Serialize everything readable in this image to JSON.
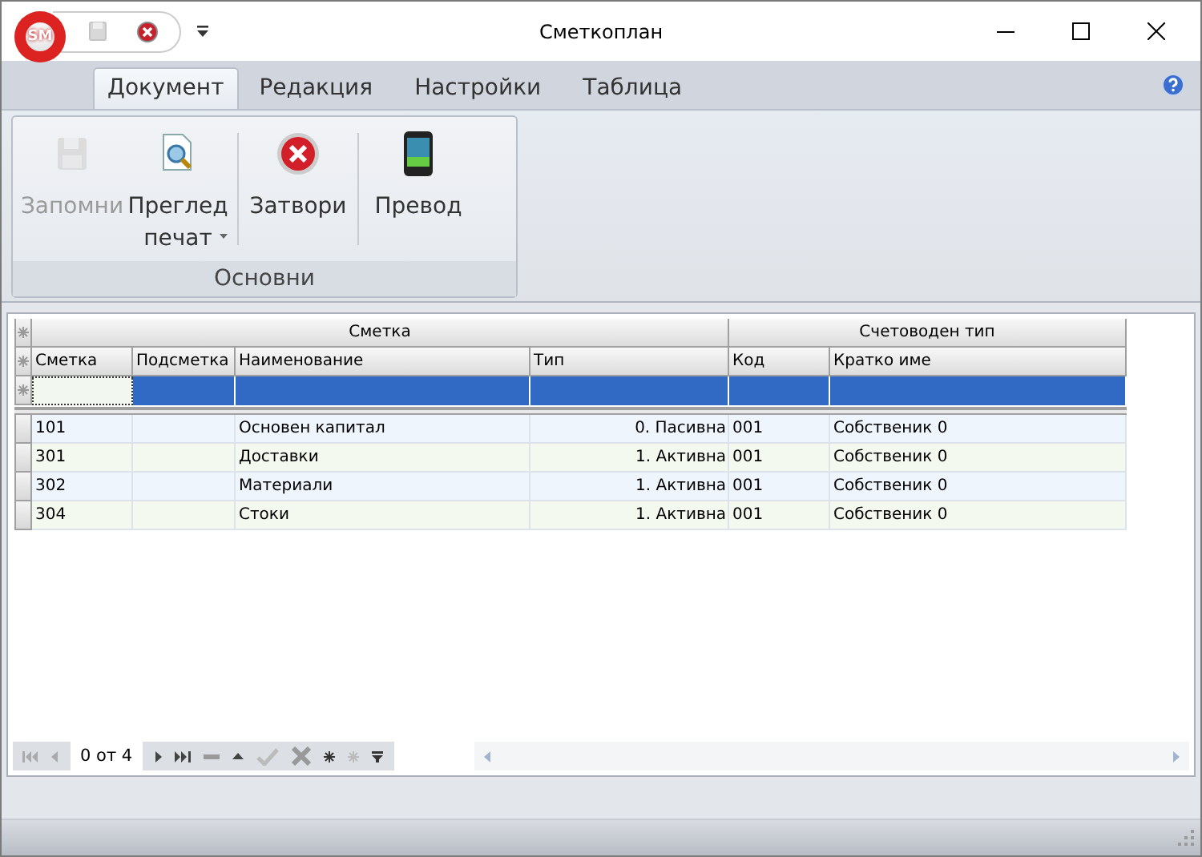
{
  "window": {
    "title": "Сметкоплан",
    "app_badge": "SM"
  },
  "tabs": [
    {
      "label": "Документ",
      "selected": true
    },
    {
      "label": "Редакция",
      "selected": false
    },
    {
      "label": "Настройки",
      "selected": false
    },
    {
      "label": "Таблица",
      "selected": false
    }
  ],
  "ribbon": {
    "group_label": "Основни",
    "buttons": [
      {
        "kind": "save",
        "label": "Запомни",
        "disabled": true,
        "dropdown": false
      },
      {
        "kind": "preview",
        "label": "Преглед печат",
        "disabled": false,
        "dropdown": true
      },
      {
        "kind": "close",
        "label": "Затвори",
        "disabled": false,
        "dropdown": false
      },
      {
        "kind": "translate",
        "label": "Превод",
        "disabled": false,
        "dropdown": false
      }
    ]
  },
  "table": {
    "bands": [
      {
        "label": "Сметка"
      },
      {
        "label": "Счетоводен тип"
      }
    ],
    "columns": [
      "Сметка",
      "Подсметка",
      "Наименование",
      "Тип",
      "Код",
      "Кратко име"
    ],
    "new_row": {
      "selected": true
    },
    "rows": [
      {
        "cells": [
          "101",
          "",
          "Основен капитал",
          "0. Пасивна",
          "001",
          "Собственик 0"
        ]
      },
      {
        "cells": [
          "301",
          "",
          "Доставки",
          "1. Активна",
          "001",
          "Собственик 0"
        ]
      },
      {
        "cells": [
          "302",
          "",
          "Материали",
          "1. Активна",
          "001",
          "Собственик 0"
        ]
      },
      {
        "cells": [
          "304",
          "",
          "Стоки",
          "1. Активна",
          "001",
          "Собственик 0"
        ]
      }
    ]
  },
  "navigator": {
    "position": "0 от 4"
  }
}
